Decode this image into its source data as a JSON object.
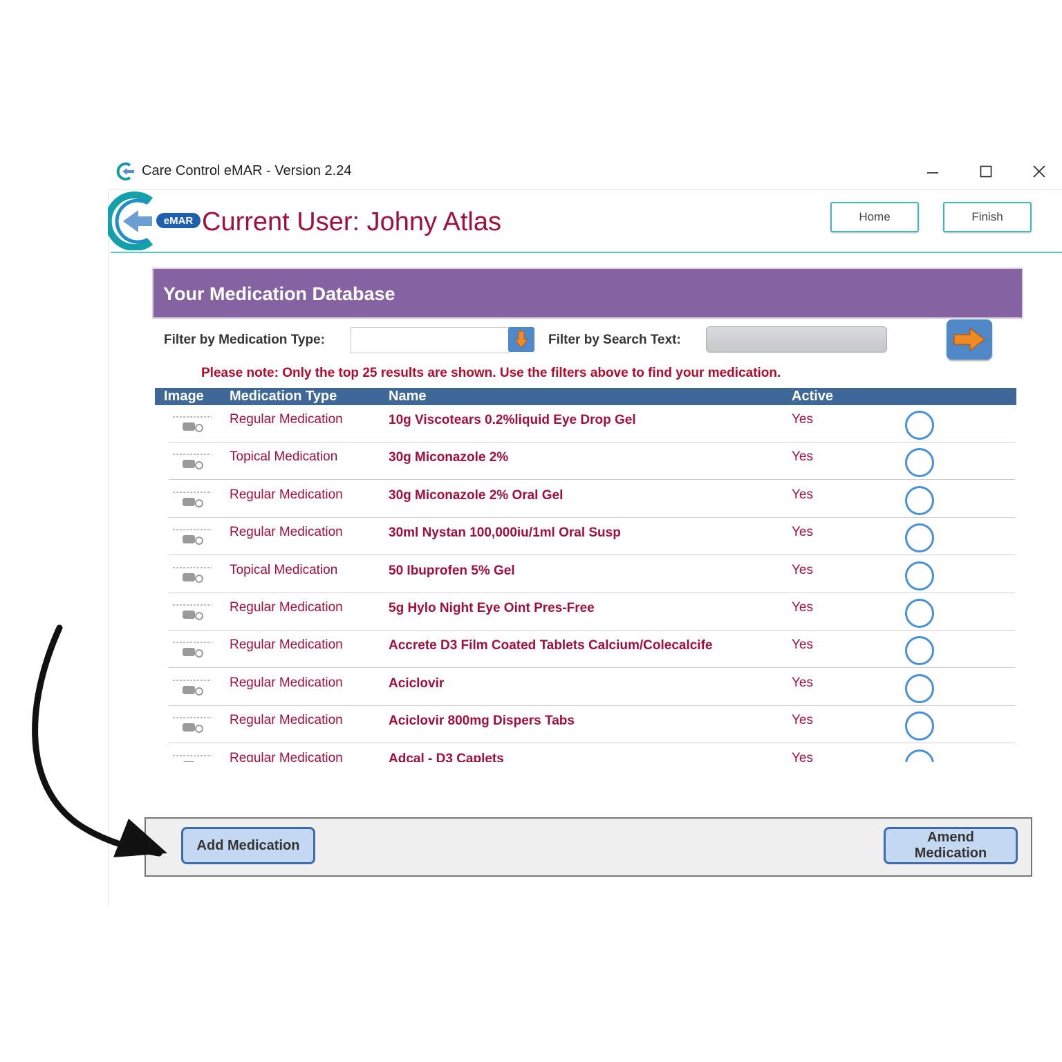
{
  "window": {
    "title": "Care Control eMAR - Version 2.24"
  },
  "header": {
    "logo_badge": "eMAR",
    "current_user": "Current User: Johny Atlas",
    "home_label": "Home",
    "finish_label": "Finish"
  },
  "db": {
    "title": "Your Medication Database"
  },
  "filters": {
    "type_label": "Filter by Medication Type:",
    "type_value": "",
    "search_label": "Filter by Search Text:",
    "search_value": ""
  },
  "notice": "Please note: Only the top 25 results are shown.  Use the filters above to find your medication.",
  "table": {
    "columns": [
      "Image",
      "Medication Type",
      "Name",
      "Active"
    ],
    "rows": [
      {
        "type": "Regular Medication",
        "name": "10g Viscotears 0.2%liquid Eye Drop Gel",
        "active": "Yes"
      },
      {
        "type": "Topical Medication",
        "name": "30g Miconazole 2%",
        "active": "Yes"
      },
      {
        "type": "Regular Medication",
        "name": "30g Miconazole 2% Oral Gel",
        "active": "Yes"
      },
      {
        "type": "Regular Medication",
        "name": "30ml Nystan 100,000iu/1ml Oral Susp",
        "active": "Yes"
      },
      {
        "type": "Topical Medication",
        "name": "50 Ibuprofen 5% Gel",
        "active": "Yes"
      },
      {
        "type": "Regular Medication",
        "name": "5g Hylo Night Eye Oint Pres-Free",
        "active": "Yes"
      },
      {
        "type": "Regular Medication",
        "name": "Accrete D3 Film Coated Tablets Calcium/Colecalcife",
        "active": "Yes"
      },
      {
        "type": "Regular Medication",
        "name": "Aciclovir",
        "active": "Yes"
      },
      {
        "type": "Regular Medication",
        "name": "Aciclovir 800mg Dispers Tabs",
        "active": "Yes"
      },
      {
        "type": "Regular Medication",
        "name": "Adcal - D3 Caplets",
        "active": "Yes"
      }
    ]
  },
  "footer": {
    "add_label": "Add Medication",
    "amend_label": "Amend Medication"
  },
  "colors": {
    "accent_teal": "#3fb8b8",
    "title_purple": "#8463a0",
    "header_blue": "#3f6797",
    "text_crimson": "#a0103a",
    "button_blue": "#4f87c7",
    "arrow_orange": "#f08a24"
  },
  "icons": {
    "app": "care-control-logo-icon",
    "minimize": "minimize-icon",
    "maximize": "maximize-icon",
    "close": "close-icon",
    "dropdown": "down-arrow-icon",
    "go": "right-arrow-icon",
    "row_image": "medication-placeholder-icon",
    "annotation": "curved-arrow-icon"
  }
}
